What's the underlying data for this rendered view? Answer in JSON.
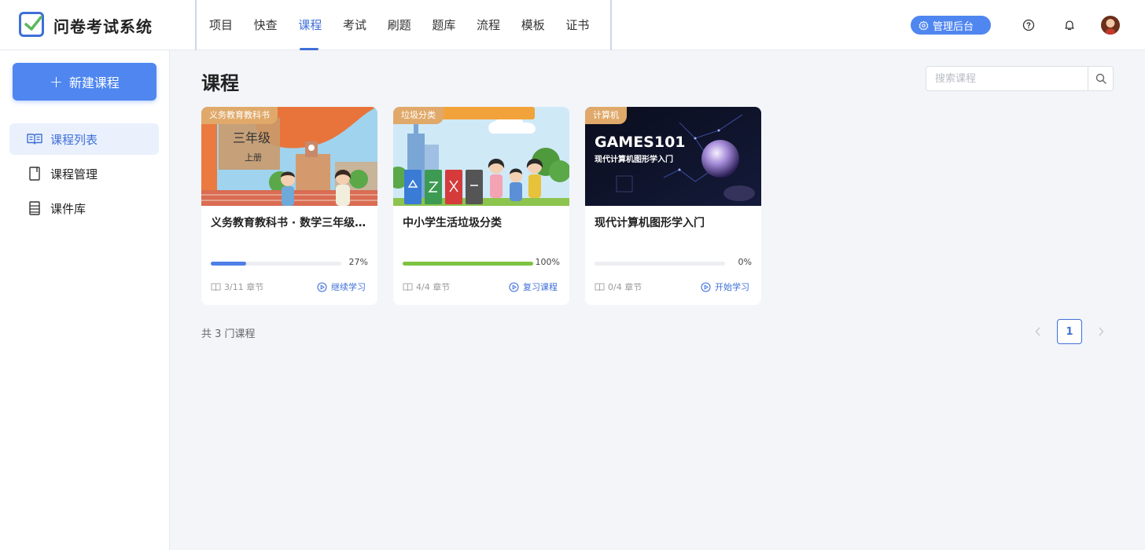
{
  "app": {
    "title": "问卷考试系统"
  },
  "nav": {
    "items": [
      "项目",
      "快查",
      "课程",
      "考试",
      "刷题",
      "题库",
      "流程",
      "模板",
      "证书"
    ],
    "active_index": 2
  },
  "header": {
    "admin_label": "管理后台"
  },
  "sidebar": {
    "new_button": "新建课程",
    "items": [
      {
        "label": "课程列表",
        "active": true
      },
      {
        "label": "课程管理",
        "active": false
      },
      {
        "label": "课件库",
        "active": false
      }
    ]
  },
  "main": {
    "title": "课程",
    "search_placeholder": "搜索课程",
    "total_text": "共 3 门课程",
    "page": "1"
  },
  "courses": [
    {
      "tag": "义务教育教科书",
      "title": "义务教育教科书 · 数学三年级上册",
      "progress": 27,
      "progress_text": "27%",
      "chapters": "3/11 章节",
      "action": "继续学习",
      "bar_color": "#4f7fe8",
      "cover_text_1": "三年级",
      "cover_text_2": "上册"
    },
    {
      "tag": "垃圾分类",
      "title": "中小学生活垃圾分类",
      "progress": 100,
      "progress_text": "100%",
      "chapters": "4/4 章节",
      "action": "复习课程",
      "bar_color": "#7cc243"
    },
    {
      "tag": "计算机",
      "title": "现代计算机图形学入门",
      "progress": 0,
      "progress_text": "0%",
      "chapters": "0/4 章节",
      "action": "开始学习",
      "bar_color": "#4f7fe8",
      "cover_text_1": "GAMES101",
      "cover_text_2": "现代计算机图形学入门"
    }
  ],
  "colors": {
    "accent": "#3f6fd8",
    "button": "#4f86f0",
    "tag": "#e0a96a"
  }
}
